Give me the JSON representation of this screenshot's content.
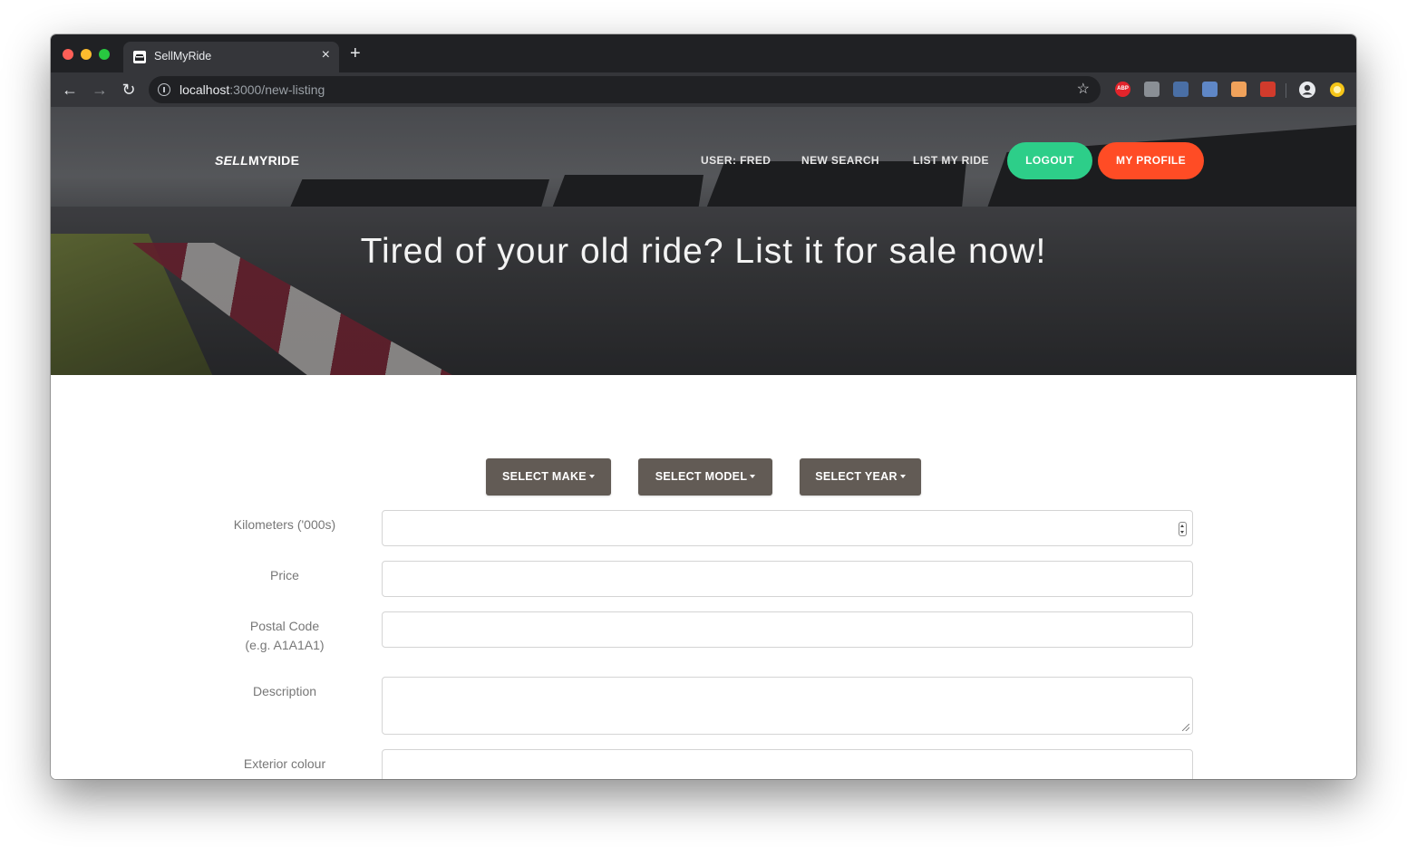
{
  "browser": {
    "tab_title": "SellMyRide",
    "tab_close": "×",
    "new_tab": "+",
    "url_host": "localhost",
    "url_path": ":3000/new-listing",
    "back": "←",
    "forward": "→",
    "reload": "↻",
    "star": "☆",
    "extensions": [
      {
        "name": "adblock-plus-icon",
        "label": "ABP",
        "color": "#e3242b"
      },
      {
        "name": "translate-icon",
        "label": "",
        "color": "#8a8f95"
      },
      {
        "name": "owl-icon",
        "label": "",
        "color": "#4a6fa5"
      },
      {
        "name": "ring-icon",
        "label": "",
        "color": "#5f87c6"
      },
      {
        "name": "face-icon",
        "label": "",
        "color": "#f0a25b"
      },
      {
        "name": "puzzle-icon",
        "label": "",
        "color": "#d23b2c"
      }
    ]
  },
  "nav": {
    "brand_sell": "SELL",
    "brand_rest": "MYRIDE",
    "user": "USER: FRED",
    "new_search": "NEW SEARCH",
    "list_my_ride": "LIST MY RIDE",
    "logout": "LOGOUT",
    "my_profile": "MY PROFILE"
  },
  "hero": {
    "headline": "Tired of your old ride? List it for sale now!"
  },
  "dropdowns": {
    "make": "SELECT MAKE",
    "model": "SELECT MODEL",
    "year": "SELECT YEAR"
  },
  "form": {
    "kilometers_label": "Kilometers ('000s)",
    "price_label": "Price",
    "postal_label_line1": "Postal Code",
    "postal_label_line2": "(e.g. A1A1A1)",
    "description_label": "Description",
    "exterior_label": "Exterior colour"
  },
  "colors": {
    "logout": "#2dce89",
    "my_profile": "#ff4c25",
    "dropdown": "#625b55"
  }
}
